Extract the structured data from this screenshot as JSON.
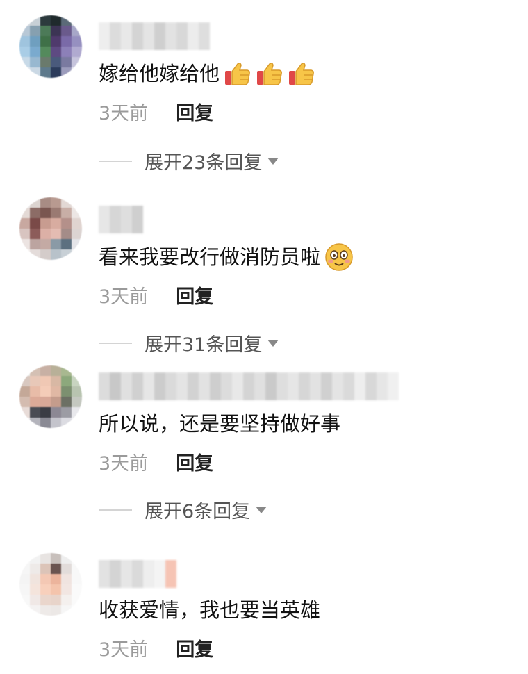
{
  "comments": [
    {
      "text": "嫁给他嫁给他",
      "emojis": [
        "thumbs-up-icon",
        "thumbs-up-icon",
        "thumbs-up-icon"
      ],
      "time": "3天前",
      "reply_label": "回复",
      "expand_label": "展开23条回复"
    },
    {
      "text": "看来我要改行做消防员啦",
      "emojis": [
        "smiling-face-icon"
      ],
      "time": "3天前",
      "reply_label": "回复",
      "expand_label": "展开31条回复"
    },
    {
      "text": "所以说，还是要坚持做好事",
      "emojis": [],
      "time": "3天前",
      "reply_label": "回复",
      "expand_label": "展开6条回复"
    },
    {
      "text": "收获爱情，我也要当英雄",
      "emojis": [],
      "time": "3天前",
      "reply_label": "回复"
    }
  ],
  "colors": {
    "text": "#111111",
    "meta": "#9a9a9a",
    "reply": "#222222",
    "expand": "#555555",
    "emoji_yellow": "#f7c548",
    "emoji_red": "#e04848"
  }
}
